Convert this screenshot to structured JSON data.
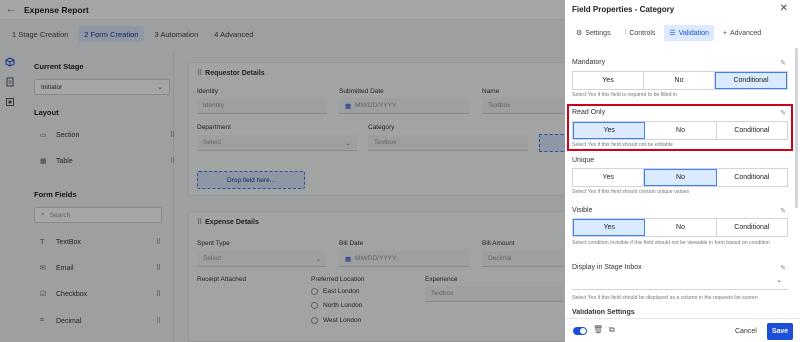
{
  "header": {
    "title": "Expense Report"
  },
  "steps": [
    {
      "label": "1  Stage Creation"
    },
    {
      "label": "2  Form Creation"
    },
    {
      "label": "3  Automation"
    },
    {
      "label": "4  Advanced"
    }
  ],
  "left": {
    "current_stage_heading": "Current Stage",
    "current_stage_value": "Initiator",
    "layout_heading": "Layout",
    "layout_items": [
      "Section",
      "Table"
    ],
    "form_fields_heading": "Form Fields",
    "search_placeholder": "Search",
    "form_fields": [
      "TextBox",
      "Email",
      "Checkbox",
      "Decimal"
    ]
  },
  "canvas": {
    "requestor_title": "Requestor Details",
    "identity_label": "Identity",
    "identity_placeholder": "Identity",
    "submitted_label": "Submitted Date",
    "submitted_placeholder": "MM/DD/YYYY",
    "name_label": "Name",
    "name_placeholder": "Textbox",
    "department_label": "Department",
    "department_placeholder": "Select",
    "category_label": "Category",
    "category_placeholder": "Textbox",
    "drop_text": "Drop field here...",
    "expense_title": "Expense Details",
    "spent_label": "Spent Type",
    "spent_placeholder": "Select",
    "bill_date_label": "Bill Date",
    "bill_date_placeholder": "MM/DD/YYYY",
    "bill_amount_label": "Bill Amount",
    "bill_amount_placeholder": "Decimal",
    "receipt_label": "Receipt Attached",
    "preferred_label": "Preferred Location",
    "locations": [
      "East London",
      "North London",
      "West London"
    ],
    "experience_label": "Experience",
    "experience_placeholder": "Textbox"
  },
  "panel": {
    "title": "Field Properties - Category",
    "tabs": [
      "Settings",
      "Controls",
      "Validation",
      "Advanced"
    ],
    "mandatory": {
      "label": "Mandatory",
      "options": [
        "Yes",
        "No",
        "Conditional"
      ],
      "selected": "Conditional",
      "hint": "Select Yes if this field is required to be filled in"
    },
    "readonly": {
      "label": "Read Only",
      "options": [
        "Yes",
        "No",
        "Conditional"
      ],
      "selected": "Yes",
      "hint": "Select Yes if this field should not be editable"
    },
    "unique": {
      "label": "Unique",
      "options": [
        "Yes",
        "No",
        "Conditional"
      ],
      "selected": "No",
      "hint": "Select Yes if this field should contain unique values"
    },
    "visible": {
      "label": "Visible",
      "options": [
        "Yes",
        "No",
        "Conditional"
      ],
      "selected": "Yes",
      "hint": "Select condition Invisible if this field should not be viewable in form based on condition"
    },
    "display_inbox": {
      "label": "Display in Stage Inbox",
      "hint": "Select Yes if this field should be displayed as a column in the requests list screen"
    },
    "validation_settings": "Validation Settings",
    "cancel": "Cancel",
    "save": "Save"
  },
  "colors": {
    "accent": "#1d4ed8",
    "highlight": "#d0021b",
    "selected_bg": "#dbeafe"
  }
}
